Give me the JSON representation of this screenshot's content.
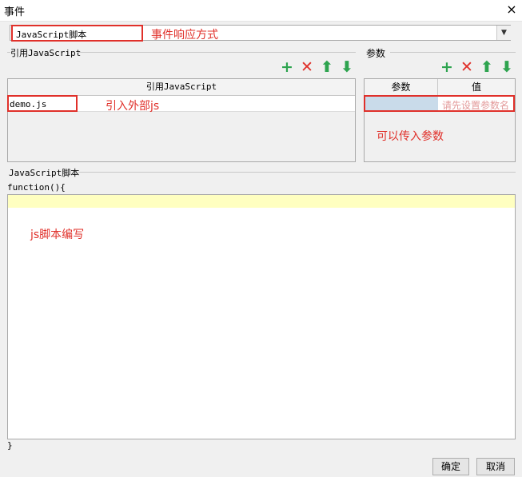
{
  "window": {
    "title": "事件",
    "close_icon": "×"
  },
  "event_type": {
    "selected": "JavaScript脚本",
    "annotation": "事件响应方式"
  },
  "ref_section": {
    "label": "引用JavaScript",
    "column_header": "引用JavaScript",
    "rows": [
      "demo.js"
    ],
    "annotation": "引入外部js"
  },
  "param_section": {
    "label": "参数",
    "columns": [
      "参数",
      "值"
    ],
    "placeholder": "请先设置参数名",
    "annotation": "可以传入参数"
  },
  "toolbar": {
    "add": "+",
    "delete": "✕",
    "up": "⬆",
    "down": "⬇"
  },
  "script_section": {
    "label": "JavaScript脚本",
    "open_line": "function(){",
    "close_line": "}",
    "annotation": "js脚本编写"
  },
  "buttons": {
    "ok": "确定",
    "cancel": "取消"
  },
  "colors": {
    "annotation_red": "#e0302a",
    "icon_green": "#2ea44f",
    "editor_highlight": "#ffffc0",
    "param_cell_selected": "#c9dbea"
  }
}
